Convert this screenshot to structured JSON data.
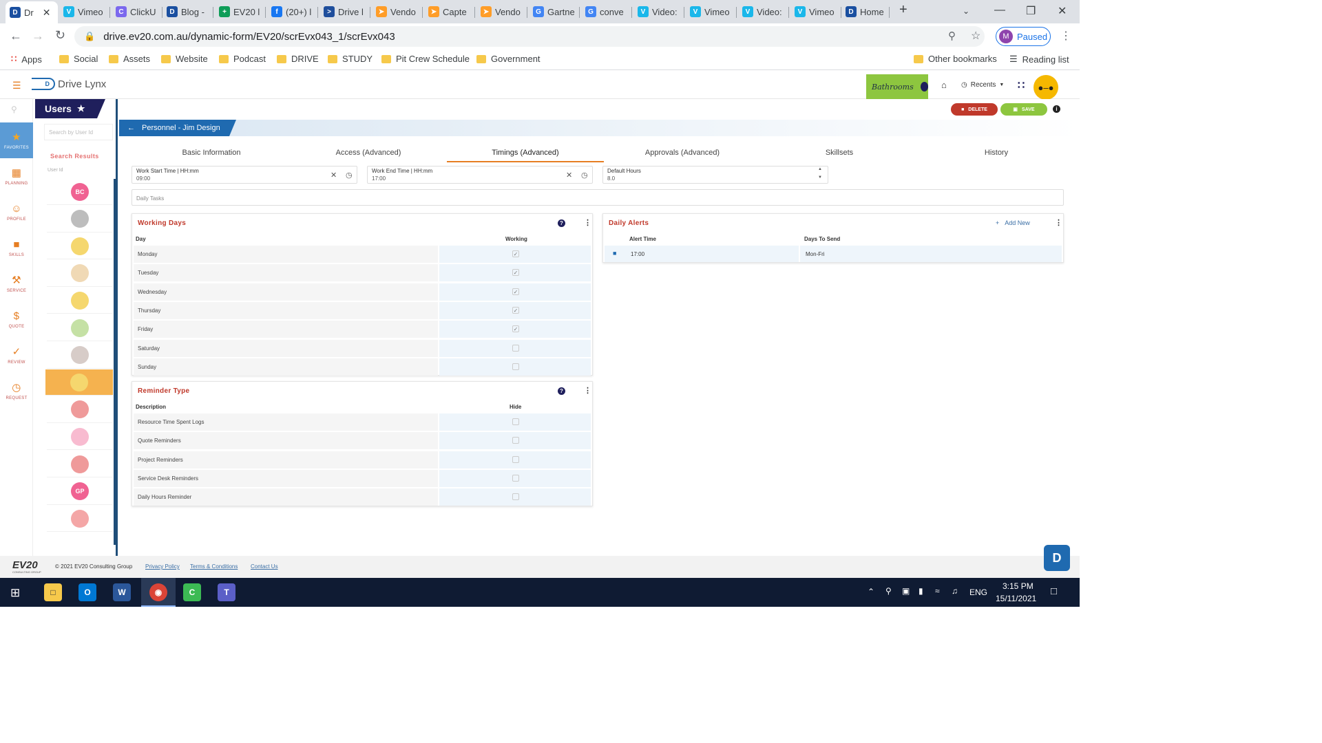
{
  "browser": {
    "tabs": [
      {
        "label": "Dr",
        "icon": "drivelynx-icon",
        "color": "#1a4fa0"
      },
      {
        "label": "Vimeo",
        "icon": "vimeo-icon",
        "color": "#1ab7ea"
      },
      {
        "label": "ClickU",
        "icon": "clickup-icon",
        "color": "#7b68ee"
      },
      {
        "label": "Blog -",
        "icon": "drivelynx-icon",
        "color": "#1a4fa0"
      },
      {
        "label": "EV20 l",
        "icon": "sheets-plus-icon",
        "color": "#0f9d58"
      },
      {
        "label": "(20+) l",
        "icon": "facebook-icon",
        "color": "#1877f2"
      },
      {
        "label": "Drive l",
        "icon": "play-icon",
        "color": "#1f4e9c"
      },
      {
        "label": "Vendo",
        "icon": "capterra-icon",
        "color": "#ff9d28"
      },
      {
        "label": "Capte",
        "icon": "capterra-icon",
        "color": "#ff9d28"
      },
      {
        "label": "Vendo",
        "icon": "capterra-icon",
        "color": "#ff9d28"
      },
      {
        "label": "Gartne",
        "icon": "google-icon",
        "color": "#4285f4"
      },
      {
        "label": "conve",
        "icon": "google-icon",
        "color": "#4285f4"
      },
      {
        "label": "Video:",
        "icon": "vimeo-icon",
        "color": "#1ab7ea"
      },
      {
        "label": "Vimeo",
        "icon": "vimeo-icon",
        "color": "#1ab7ea"
      },
      {
        "label": "Video:",
        "icon": "vimeo-icon",
        "color": "#1ab7ea"
      },
      {
        "label": "Vimeo",
        "icon": "vimeo-icon",
        "color": "#1ab7ea"
      },
      {
        "label": "Home",
        "icon": "drivelynx-icon",
        "color": "#1a4fa0"
      }
    ],
    "url": "drive.ev20.com.au/dynamic-form/EV20/scrEvx043_1/scrEvx043",
    "profile_initial": "M",
    "profile_status": "Paused",
    "bookmarks": [
      "Apps",
      "Social",
      "Assets",
      "Website",
      "Podcast",
      "DRIVE",
      "STUDY",
      "Pit Crew Schedule",
      "Government"
    ],
    "other_bookmarks": "Other bookmarks",
    "reading_list": "Reading list"
  },
  "app": {
    "logo_text": "Drive Lynx",
    "sponsor_text": "Bathrooms",
    "recents_label": "Recents",
    "delete_label": "DELETE",
    "save_label": "SAVE",
    "nav": [
      {
        "label": "FAVORITES",
        "icon": "star-icon"
      },
      {
        "label": "PLANNING",
        "icon": "calendar-icon"
      },
      {
        "label": "PROFILE",
        "icon": "people-icon"
      },
      {
        "label": "SKILLS",
        "icon": "briefcase-icon"
      },
      {
        "label": "SERVICE",
        "icon": "wrench-icon"
      },
      {
        "label": "QUOTE",
        "icon": "dollar-icon"
      },
      {
        "label": "REVIEW",
        "icon": "check-icon"
      },
      {
        "label": "REQUEST",
        "icon": "clock-icon"
      }
    ],
    "users_title": "Users",
    "search_placeholder": "Search by User Id",
    "search_results_label": "Search Results",
    "user_id_label": "User Id",
    "users": [
      {
        "initials": "BC",
        "color": "#f06292"
      },
      {
        "initials": "",
        "color": "#bdbdbd"
      },
      {
        "initials": "",
        "color": "#f5d76e"
      },
      {
        "initials": "",
        "color": "#f0d9b5"
      },
      {
        "initials": "",
        "color": "#f5d76e"
      },
      {
        "initials": "",
        "color": "#c5e1a5"
      },
      {
        "initials": "",
        "color": "#d7ccc8"
      },
      {
        "initials": "",
        "color": "#f5d76e"
      },
      {
        "initials": "",
        "color": "#ef9a9a"
      },
      {
        "initials": "",
        "color": "#f8bbd0"
      },
      {
        "initials": "",
        "color": "#ef9a9a"
      },
      {
        "initials": "GP",
        "color": "#f06292"
      },
      {
        "initials": "",
        "color": "#f4a6a6"
      }
    ],
    "breadcrumb": "Personnel - Jim Design",
    "tabs": [
      "Basic Information",
      "Access (Advanced)",
      "Timings (Advanced)",
      "Approvals (Advanced)",
      "Skillsets",
      "History"
    ],
    "active_tab": 2,
    "work_start": {
      "label": "Work Start Time | HH:mm",
      "value": "09:00"
    },
    "work_end": {
      "label": "Work End Time | HH:mm",
      "value": "17:00"
    },
    "default_hours": {
      "label": "Default Hours",
      "value": "8.0"
    },
    "daily_tasks_placeholder": "Daily Tasks",
    "working_days": {
      "title": "Working Days",
      "col_day": "Day",
      "col_working": "Working",
      "rows": [
        {
          "day": "Monday",
          "checked": true
        },
        {
          "day": "Tuesday",
          "checked": true
        },
        {
          "day": "Wednesday",
          "checked": true
        },
        {
          "day": "Thursday",
          "checked": true
        },
        {
          "day": "Friday",
          "checked": true
        },
        {
          "day": "Saturday",
          "checked": false
        },
        {
          "day": "Sunday",
          "checked": false
        }
      ]
    },
    "reminder_type": {
      "title": "Reminder Type",
      "col_desc": "Description",
      "col_hide": "Hide",
      "rows": [
        {
          "desc": "Resource Time Spent Logs",
          "checked": false
        },
        {
          "desc": "Quote Reminders",
          "checked": false
        },
        {
          "desc": "Project Reminders",
          "checked": false
        },
        {
          "desc": "Service Desk Reminders",
          "checked": false
        },
        {
          "desc": "Daily Hours Reminder",
          "checked": false
        }
      ]
    },
    "daily_alerts": {
      "title": "Daily Alerts",
      "add_new": "Add New",
      "col_time": "Alert Time",
      "col_days": "Days To Send",
      "rows": [
        {
          "time": "17:00",
          "days": "Mon-Fri"
        }
      ]
    },
    "footer": {
      "logo": "EV20",
      "logo_sub": "CONSULTING GROUP",
      "copyright": "© 2021 EV20 Consulting Group",
      "links": [
        "Privacy Policy",
        "Terms & Conditions",
        "Contact Us"
      ]
    }
  },
  "taskbar": {
    "lang": "ENG",
    "time": "3:15 PM",
    "date": "15/11/2021"
  }
}
